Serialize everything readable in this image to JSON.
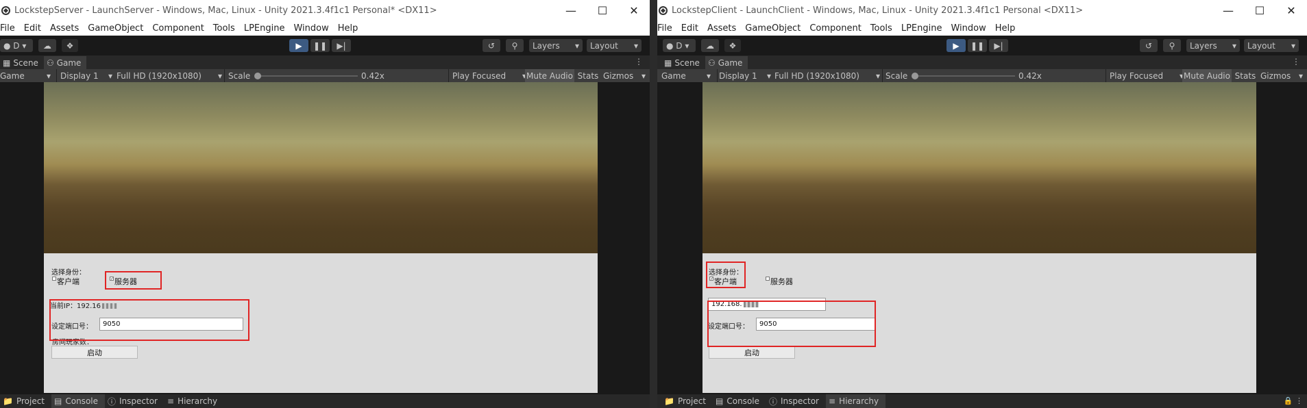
{
  "left": {
    "title": "LockstepServer - LaunchServer - Windows, Mac, Linux - Unity 2021.3.4f1c1 Personal* <DX11>",
    "menu": [
      "File",
      "Edit",
      "Assets",
      "GameObject",
      "Component",
      "Tools",
      "LPEngine",
      "Window",
      "Help"
    ],
    "account": "D",
    "layers": "Layers",
    "layout": "Layout",
    "tabs": {
      "scene": "Scene",
      "game": "Game"
    },
    "game_toolbar": {
      "mode": "Game",
      "display": "Display 1",
      "resolution": "Full HD (1920x1080)",
      "scale_label": "Scale",
      "scale_value": "0.42x",
      "play_mode": "Play Focused",
      "mute": "Mute Audio",
      "stats": "Stats",
      "gizmos": "Gizmos"
    },
    "panel": {
      "identity_label": "选择身份：",
      "client_label": "客户端",
      "server_label": "服务器",
      "ip_label": "当前IP：192.16",
      "port_label": "设定端口号：",
      "port_value": "9050",
      "players_label": "房间玩家数：",
      "start_label": "启动"
    },
    "bottom_tabs": [
      "Project",
      "Console",
      "Inspector",
      "Hierarchy"
    ]
  },
  "right": {
    "title": "LockstepClient - LaunchClient - Windows, Mac, Linux - Unity 2021.3.4f1c1 Personal <DX11>",
    "menu": [
      "File",
      "Edit",
      "Assets",
      "GameObject",
      "Component",
      "Tools",
      "LPEngine",
      "Window",
      "Help"
    ],
    "account": "D",
    "layers": "Layers",
    "layout": "Layout",
    "tabs": {
      "scene": "Scene",
      "game": "Game"
    },
    "game_toolbar": {
      "mode": "Game",
      "display": "Display 1",
      "resolution": "Full HD (1920x1080)",
      "scale_label": "Scale",
      "scale_value": "0.42x",
      "play_mode": "Play Focused",
      "mute": "Mute Audio",
      "stats": "Stats",
      "gizmos": "Gizmos"
    },
    "panel": {
      "identity_label": "选择身份：",
      "client_label": "客户端",
      "server_label": "服务器",
      "ip_value": "192.168.",
      "port_label": "设定端口号：",
      "port_value": "9050",
      "start_label": "启动"
    },
    "bottom_tabs": [
      "Project",
      "Console",
      "Inspector",
      "Hierarchy"
    ]
  },
  "colors": {
    "play_accent": "#3c5a82",
    "highlight_box": "#e02424",
    "editor_dark": "#191919"
  }
}
